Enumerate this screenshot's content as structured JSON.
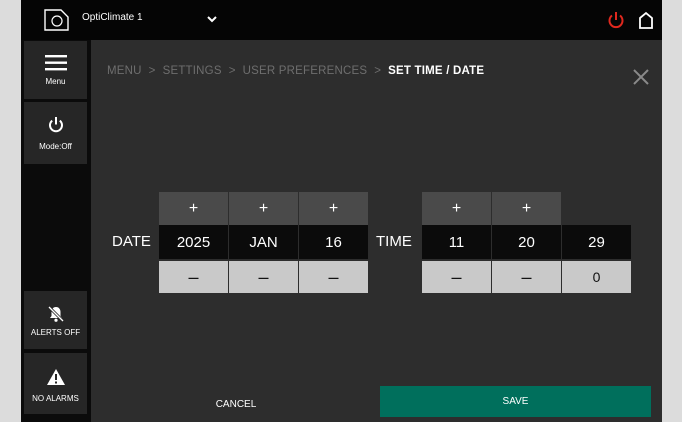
{
  "topbar": {
    "device_name": "OptiClimate 1",
    "brand_icon": "device-icon",
    "dropdown_icon": "chevron-down-icon",
    "power_icon": "power-icon",
    "home_icon": "home-icon",
    "power_color": "#e0281e"
  },
  "sidebar": {
    "menu": {
      "label": "Menu",
      "icon": "hamburger-icon"
    },
    "mode": {
      "label": "Mode:Off",
      "icon": "power-icon"
    },
    "alerts": {
      "label": "ALERTS OFF",
      "icon": "bell-off-icon"
    },
    "alarms": {
      "label": "NO ALARMS",
      "icon": "warning-icon"
    }
  },
  "breadcrumb": {
    "items": [
      "MENU",
      "SETTINGS",
      "USER PREFERENCES"
    ],
    "current": "SET TIME / DATE",
    "separator": ">"
  },
  "picker": {
    "date_label": "DATE",
    "time_label": "TIME",
    "plus": "+",
    "minus": "–",
    "date": {
      "year": "2025",
      "month": "JAN",
      "day": "16"
    },
    "time": {
      "hour": "11",
      "minute": "20",
      "second": "29",
      "second_reset": "0"
    }
  },
  "footer": {
    "cancel": "CANCEL",
    "save": "SAVE",
    "save_color": "#006f5c"
  }
}
